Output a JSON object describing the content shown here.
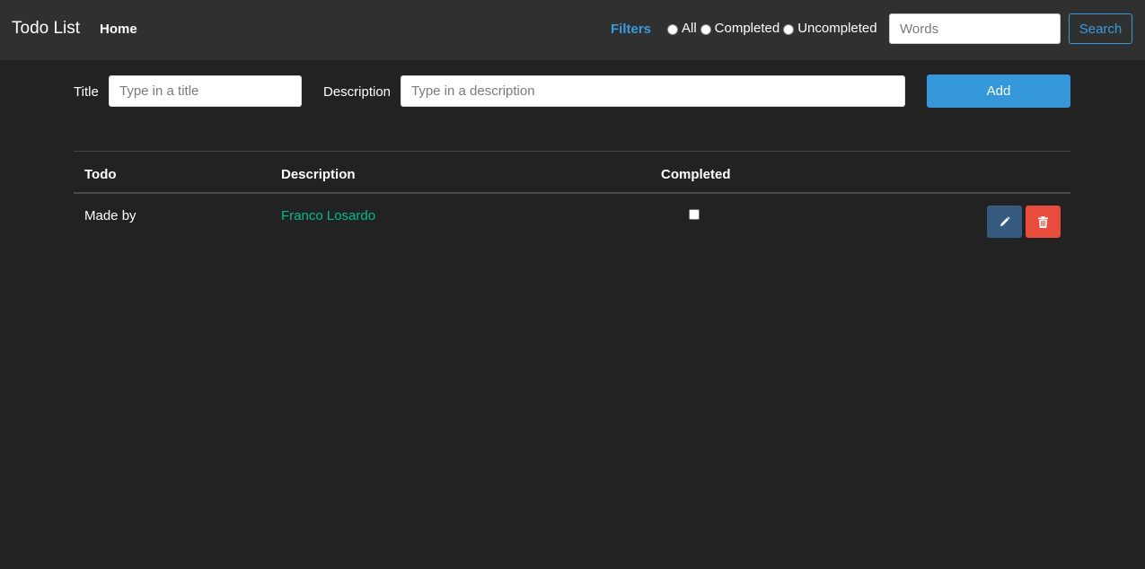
{
  "navbar": {
    "brand": "Todo List",
    "home_label": "Home",
    "filters_label": "Filters",
    "radio_options": [
      "All",
      "Completed",
      "Uncompleted"
    ],
    "search_placeholder": "Words",
    "search_button_label": "Search"
  },
  "form": {
    "title_label": "Title",
    "title_placeholder": "Type in a title",
    "description_label": "Description",
    "description_placeholder": "Type in a description",
    "add_button_label": "Add"
  },
  "table": {
    "columns": [
      "Todo",
      "Description",
      "Completed"
    ],
    "rows": [
      {
        "todo": "Made by",
        "description": "Franco Losardo",
        "completed": false
      }
    ]
  },
  "colors": {
    "background": "#222222",
    "navbar": "#303030",
    "accent_blue": "#3498db",
    "link_green": "#00bc8c",
    "edit_button": "#375a7f",
    "delete_button": "#e74c3c"
  },
  "icons": {
    "edit": "pencil-icon",
    "delete": "trash-icon"
  }
}
